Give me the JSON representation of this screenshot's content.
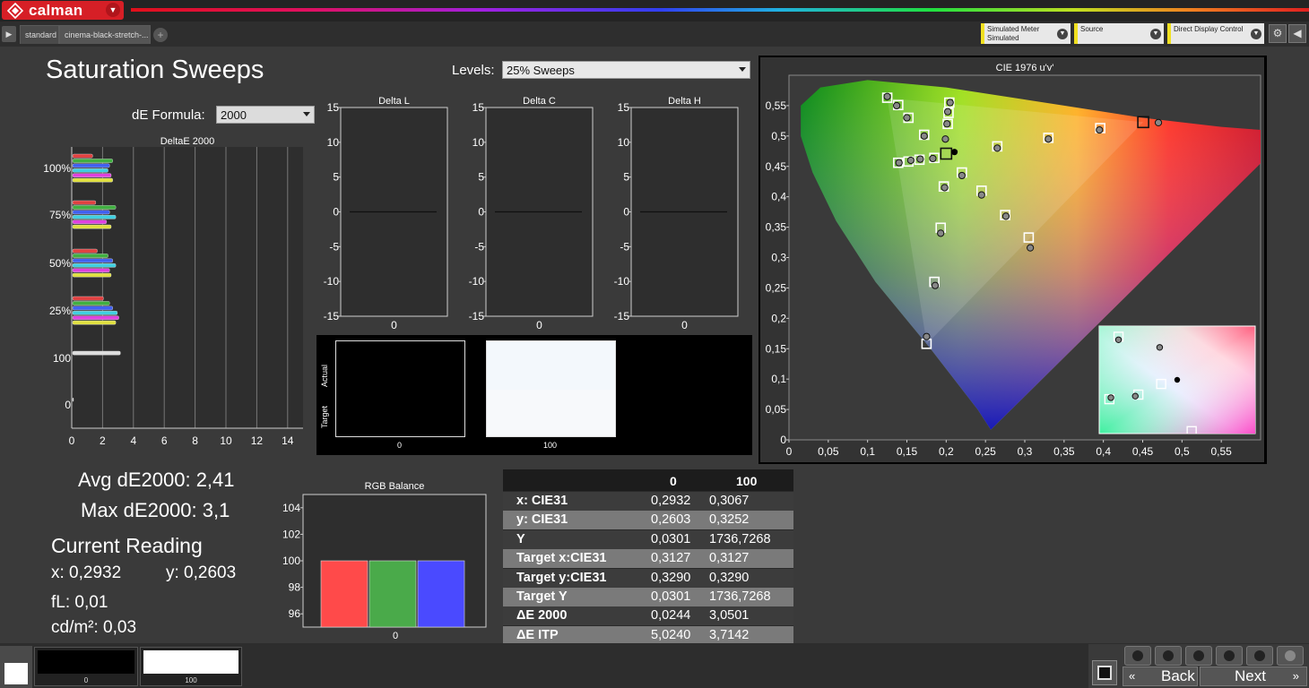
{
  "app": {
    "name": "calman"
  },
  "tabs": [
    "standard",
    "cinema-black-stretch-..."
  ],
  "devices": [
    {
      "line1": "Simulated Meter",
      "line2": "Simulated"
    },
    {
      "line1": "Source",
      "line2": ""
    },
    {
      "line1": "Direct Display Control",
      "line2": ""
    }
  ],
  "page_title": "Saturation Sweeps",
  "levels": {
    "label": "Levels:",
    "value": "25% Sweeps"
  },
  "formula": {
    "label": "dE Formula:",
    "value": "2000"
  },
  "readouts": {
    "avg": "Avg dE2000: 2,41",
    "max": "Max dE2000: 3,1",
    "current_title": "Current Reading",
    "x": "x: 0,2932",
    "y": "y: 0,2603",
    "fl": "fL: 0,01",
    "cdm2": "cd/m²: 0,03"
  },
  "swatch_panel": {
    "actual_label": "Actual",
    "target_label": "Target",
    "labels": [
      "0",
      "100"
    ],
    "colors": {
      "actual_0": "#000000",
      "target_0": "#000000",
      "actual_100": "#f3f8fc",
      "target_100": "#f7f9fb"
    }
  },
  "table": {
    "columns": [
      "0",
      "100"
    ],
    "rows": [
      {
        "label": "x: CIE31",
        "v0": "0,2932",
        "v1": "0,3067"
      },
      {
        "label": "y: CIE31",
        "v0": "0,2603",
        "v1": "0,3252"
      },
      {
        "label": "Y",
        "v0": "0,0301",
        "v1": "1736,7268"
      },
      {
        "label": "Target x:CIE31",
        "v0": "0,3127",
        "v1": "0,3127"
      },
      {
        "label": "Target y:CIE31",
        "v0": "0,3290",
        "v1": "0,3290"
      },
      {
        "label": "Target Y",
        "v0": "0,0301",
        "v1": "1736,7268"
      },
      {
        "label": "ΔE 2000",
        "v0": "0,0244",
        "v1": "3,0501"
      },
      {
        "label": "ΔE ITP",
        "v0": "5,0240",
        "v1": "3,7142"
      }
    ]
  },
  "bottom": {
    "swatch_labels": [
      "0",
      "100"
    ],
    "back": "Back",
    "next": "Next"
  },
  "chart_data": [
    {
      "type": "bar",
      "title": "DeltaE 2000",
      "orientation": "horizontal",
      "categories": [
        "100%",
        "75%",
        "50%",
        "25%",
        "100",
        "0"
      ],
      "xlim": [
        0,
        15
      ],
      "xticks": [
        "0",
        "2",
        "4",
        "6",
        "8",
        "10",
        "12",
        "14"
      ],
      "series": [
        {
          "color": "#e04040",
          "values": [
            1.3,
            1.5,
            1.6,
            2.0,
            null,
            null
          ]
        },
        {
          "color": "#40b040",
          "values": [
            2.6,
            2.8,
            2.3,
            2.4,
            null,
            null
          ]
        },
        {
          "color": "#4060f0",
          "values": [
            2.4,
            2.4,
            2.6,
            2.6,
            null,
            null
          ]
        },
        {
          "color": "#40d0e0",
          "values": [
            2.3,
            2.8,
            2.8,
            2.9,
            null,
            null
          ]
        },
        {
          "color": "#e040e0",
          "values": [
            2.5,
            2.2,
            2.4,
            3.0,
            null,
            null
          ]
        },
        {
          "color": "#e0e040",
          "values": [
            2.6,
            2.5,
            2.5,
            2.8,
            null,
            null
          ]
        },
        {
          "color": "#dddddd",
          "values": [
            null,
            null,
            null,
            null,
            3.1,
            0.02
          ]
        }
      ]
    },
    {
      "type": "line",
      "title": "Delta L",
      "x": [
        "0"
      ],
      "ylim": [
        -15,
        15
      ],
      "yticks": [
        "15",
        "10",
        "5",
        "0",
        "-5",
        "-10",
        "-15"
      ],
      "values": [
        0
      ]
    },
    {
      "type": "line",
      "title": "Delta C",
      "x": [
        "0"
      ],
      "ylim": [
        -15,
        15
      ],
      "yticks": [
        "15",
        "10",
        "5",
        "0",
        "-5",
        "-10",
        "-15"
      ],
      "values": [
        0
      ]
    },
    {
      "type": "line",
      "title": "Delta H",
      "x": [
        "0"
      ],
      "ylim": [
        -15,
        15
      ],
      "yticks": [
        "15",
        "10",
        "5",
        "0",
        "-5",
        "-10",
        "-15"
      ],
      "values": [
        0
      ]
    },
    {
      "type": "bar",
      "title": "RGB Balance",
      "categories": [
        "0"
      ],
      "ylim": [
        95,
        105
      ],
      "yticks": [
        "104",
        "102",
        "100",
        "98",
        "96"
      ],
      "series": [
        {
          "color": "#ff4a4a",
          "values": [
            100
          ]
        },
        {
          "color": "#4aaa4a",
          "values": [
            100
          ]
        },
        {
          "color": "#4a4aff",
          "values": [
            100
          ]
        }
      ]
    },
    {
      "type": "scatter",
      "title": "CIE 1976 u'v'",
      "xlim": [
        0,
        0.6
      ],
      "ylim": [
        0,
        0.6
      ],
      "xticks": [
        "0",
        "0,05",
        "0,1",
        "0,15",
        "0,2",
        "0,25",
        "0,3",
        "0,35",
        "0,4",
        "0,45",
        "0,5",
        "0,55"
      ],
      "yticks": [
        "0",
        "0,05",
        "0,1",
        "0,15",
        "0,2",
        "0,25",
        "0,3",
        "0,35",
        "0,4",
        "0,45",
        "0,5",
        "0,55"
      ],
      "targets": [
        [
          0.4507,
          0.5229
        ],
        [
          0.396,
          0.513
        ],
        [
          0.33,
          0.497
        ],
        [
          0.265,
          0.483
        ],
        [
          0.125,
          0.563
        ],
        [
          0.139,
          0.551
        ],
        [
          0.152,
          0.53
        ],
        [
          0.172,
          0.502
        ],
        [
          0.204,
          0.555
        ],
        [
          0.203,
          0.538
        ],
        [
          0.202,
          0.52
        ],
        [
          0.2,
          0.471
        ],
        [
          0.139,
          0.456
        ],
        [
          0.152,
          0.458
        ],
        [
          0.166,
          0.461
        ],
        [
          0.185,
          0.464
        ],
        [
          0.175,
          0.158
        ],
        [
          0.185,
          0.26
        ],
        [
          0.193,
          0.349
        ],
        [
          0.197,
          0.417
        ],
        [
          0.305,
          0.333
        ],
        [
          0.275,
          0.37
        ],
        [
          0.245,
          0.41
        ],
        [
          0.22,
          0.44
        ]
      ],
      "measured": [
        [
          0.47,
          0.522
        ],
        [
          0.395,
          0.51
        ],
        [
          0.33,
          0.495
        ],
        [
          0.265,
          0.48
        ],
        [
          0.125,
          0.565
        ],
        [
          0.137,
          0.55
        ],
        [
          0.15,
          0.53
        ],
        [
          0.172,
          0.5
        ],
        [
          0.205,
          0.555
        ],
        [
          0.202,
          0.54
        ],
        [
          0.201,
          0.52
        ],
        [
          0.199,
          0.495
        ],
        [
          0.14,
          0.456
        ],
        [
          0.155,
          0.46
        ],
        [
          0.167,
          0.462
        ],
        [
          0.183,
          0.463
        ],
        [
          0.175,
          0.17
        ],
        [
          0.186,
          0.254
        ],
        [
          0.193,
          0.34
        ],
        [
          0.198,
          0.415
        ],
        [
          0.307,
          0.316
        ],
        [
          0.276,
          0.368
        ],
        [
          0.245,
          0.403
        ],
        [
          0.22,
          0.435
        ]
      ],
      "white_point": [
        0.2105,
        0.4737
      ]
    }
  ]
}
